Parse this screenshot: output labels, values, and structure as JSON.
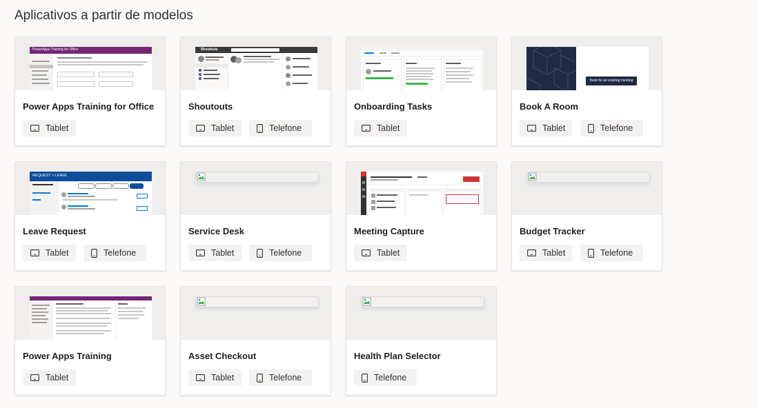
{
  "page": {
    "title": "Aplicativos a partir de modelos"
  },
  "labels": {
    "tablet": "Tablet",
    "phone": "Telefone"
  },
  "cards": [
    {
      "title": "Power Apps Training for Office",
      "thumb_header": "PowerApps Training for Office"
    },
    {
      "title": "Shoutouts",
      "thumb_header": "Shoutouts"
    },
    {
      "title": "Onboarding Tasks"
    },
    {
      "title": "Book A Room",
      "thumb_button": "Book for an existing meeting"
    },
    {
      "title": "Leave Request",
      "thumb_header": "REQUEST > LEAVE"
    },
    {
      "title": "Service Desk"
    },
    {
      "title": "Meeting Capture"
    },
    {
      "title": "Budget Tracker"
    },
    {
      "title": "Power Apps Training"
    },
    {
      "title": "Asset Checkout"
    },
    {
      "title": "Health Plan Selector"
    }
  ],
  "colors": {
    "purple_header": "#742774",
    "navy_panel": "#1f2b44",
    "blue_header": "#0f4c9a",
    "red_accent": "#d13438",
    "dark_header": "#3b3a39",
    "green_bar": "#3bb54a"
  }
}
